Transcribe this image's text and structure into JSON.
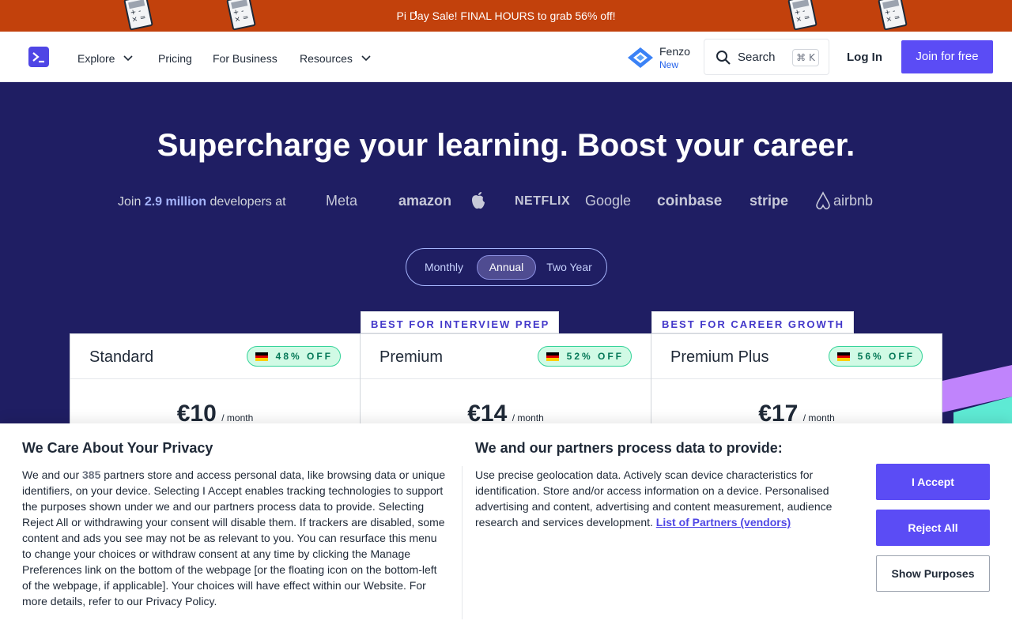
{
  "promo": {
    "text": "Pi Day Sale! FINAL HOURS to grab 56% off!",
    "calculator_icon": "calculator-icon"
  },
  "nav": {
    "items": [
      {
        "label": "Explore",
        "has_dropdown": true
      },
      {
        "label": "Pricing",
        "has_dropdown": false
      },
      {
        "label": "For Business",
        "has_dropdown": false
      },
      {
        "label": "Resources",
        "has_dropdown": true
      }
    ],
    "fenzo": {
      "name": "Fenzo",
      "badge": "New"
    },
    "search": {
      "label": "Search",
      "shortcut": "⌘ K"
    },
    "login": "Log In",
    "join": "Join for free"
  },
  "hero": {
    "title": "Supercharge your learning. Boost your career.",
    "join_prefix": "Join",
    "join_count": "2.9 million",
    "join_suffix": "developers at",
    "companies": [
      "Meta",
      "amazon",
      "apple-icon",
      "NETFLIX",
      "Google",
      "coinbase",
      "stripe",
      "airbnb"
    ]
  },
  "billing": {
    "options": [
      "Monthly",
      "Annual",
      "Two Year"
    ],
    "selected": "Annual"
  },
  "plans": [
    {
      "name": "Standard",
      "ribbon": "",
      "discount": "48% OFF",
      "price": "€10",
      "period": "/ month"
    },
    {
      "name": "Premium",
      "ribbon": "BEST FOR INTERVIEW PREP",
      "discount": "52% OFF",
      "price": "€14",
      "period": "/ month"
    },
    {
      "name": "Premium Plus",
      "ribbon": "BEST FOR CAREER GROWTH",
      "discount": "56% OFF",
      "price": "€17",
      "period": "/ month"
    }
  ],
  "privacy": {
    "title": "We Care About Your Privacy",
    "body_before": "We and our",
    "partner_count": "385",
    "body_after": "partners store and access personal data, like browsing data or unique identifiers, on your device. Selecting I Accept enables tracking technologies to support the purposes shown under we and our partners process data to provide. Selecting Reject All or withdrawing your consent will disable them. If trackers are disabled, some content and ads you see may not be as relevant to you. You can resurface this menu to change your choices or withdraw consent at any time by clicking the Manage Preferences link on the bottom of the webpage [or the floating icon on the bottom-left of the webpage, if applicable]. Your choices will have effect within our Website. For more details, refer to our Privacy Policy.",
    "title2": "We and our partners process data to provide:",
    "body2": "Use precise geolocation data. Actively scan device characteristics for identification. Store and/or access information on a device. Personalised advertising and content, advertising and content measurement, audience research and services development.",
    "link": "List of Partners (vendors)",
    "accept": "I Accept",
    "reject": "Reject All",
    "purposes": "Show Purposes"
  },
  "colors": {
    "banner": "#c2410c",
    "hero_bg": "#1f1e63",
    "brand": "#5b4cf5",
    "discount_bg": "#d1fae5"
  }
}
